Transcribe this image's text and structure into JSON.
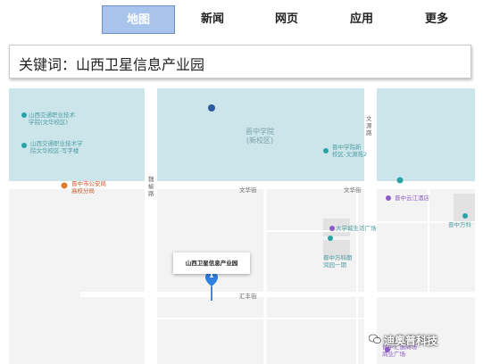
{
  "tabs": [
    {
      "label": "地图",
      "active": true
    },
    {
      "label": "新闻",
      "active": false
    },
    {
      "label": "网页",
      "active": false
    },
    {
      "label": "应用",
      "active": false
    },
    {
      "label": "更多",
      "active": false
    }
  ],
  "keyword": "关键词：山西卫星信息产业园",
  "map": {
    "labels": {
      "sx_jiaotong_tech": "山西交通职业技术\n学院(文华校区)",
      "sx_jiaotong_tech_admin": "山西交通职业技术学\n院文华校区-写字楼",
      "jinzhong_college": "晋中学院\n(新校区)",
      "jinzhong_college_new": "晋中学院新\n校区-文源苑2",
      "wenyuan_road": "文源路",
      "police_bureau": "晋中市公安局\n高校分局",
      "weiyang_road": "魏榆路",
      "wenhua_st_1": "文华街",
      "wenhua_st_2": "文华街",
      "yunjiang_hotel": "晋中云江酒店",
      "jinzhong_wanke": "晋中万科",
      "daxuecheng_plaza": "大学城生活广场",
      "wanke_langrun": "晋中万科朗\n润园一期",
      "satellite_park": "山西卫星信息产业园",
      "huifeng_st": "汇丰街",
      "huifeng_plaza": "晋中汇通商场\n商业广场",
      "marker_number": "1"
    },
    "colors": {
      "water": "#cbe5ea",
      "road": "#ffffff",
      "land": "#f3f3f3",
      "block": "#e2e2e2",
      "marker": "#2f7fe0",
      "poi_teal": "#2aa3a8",
      "poi_purple": "#8c5cc4",
      "poi_orange": "#e07a2b"
    }
  },
  "watermark": "迪奥普科技"
}
